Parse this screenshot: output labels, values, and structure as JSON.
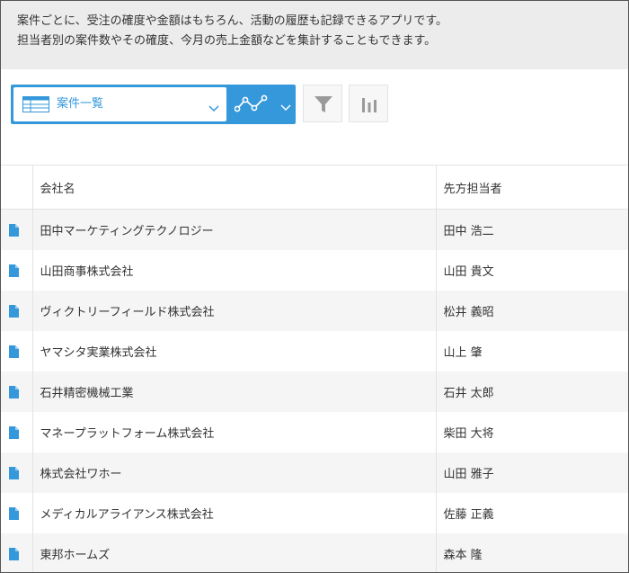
{
  "description": {
    "line1": "案件ごとに、受注の確度や金額はもちろん、活動の履歴も記録できるアプリです。",
    "line2": "担当者別の案件数やその確度、今月の売上金額などを集計することもできます。"
  },
  "toolbar": {
    "view_label": "案件一覧",
    "accent_color": "#3498db"
  },
  "table": {
    "columns": [
      "会社名",
      "先方担当者"
    ],
    "rows": [
      {
        "company": "田中マーケティングテクノロジー",
        "contact": "田中 浩二"
      },
      {
        "company": "山田商事株式会社",
        "contact": "山田 貴文"
      },
      {
        "company": "ヴィクトリーフィールド株式会社",
        "contact": "松井 義昭"
      },
      {
        "company": "ヤマシタ実業株式会社",
        "contact": "山上 肇"
      },
      {
        "company": "石井精密機械工業",
        "contact": "石井 太郎"
      },
      {
        "company": "マネープラットフォーム株式会社",
        "contact": "柴田 大将"
      },
      {
        "company": "株式会社ワホー",
        "contact": "山田 雅子"
      },
      {
        "company": "メディカルアライアンス株式会社",
        "contact": "佐藤 正義"
      },
      {
        "company": "東邦ホームズ",
        "contact": "森本 隆"
      }
    ]
  }
}
